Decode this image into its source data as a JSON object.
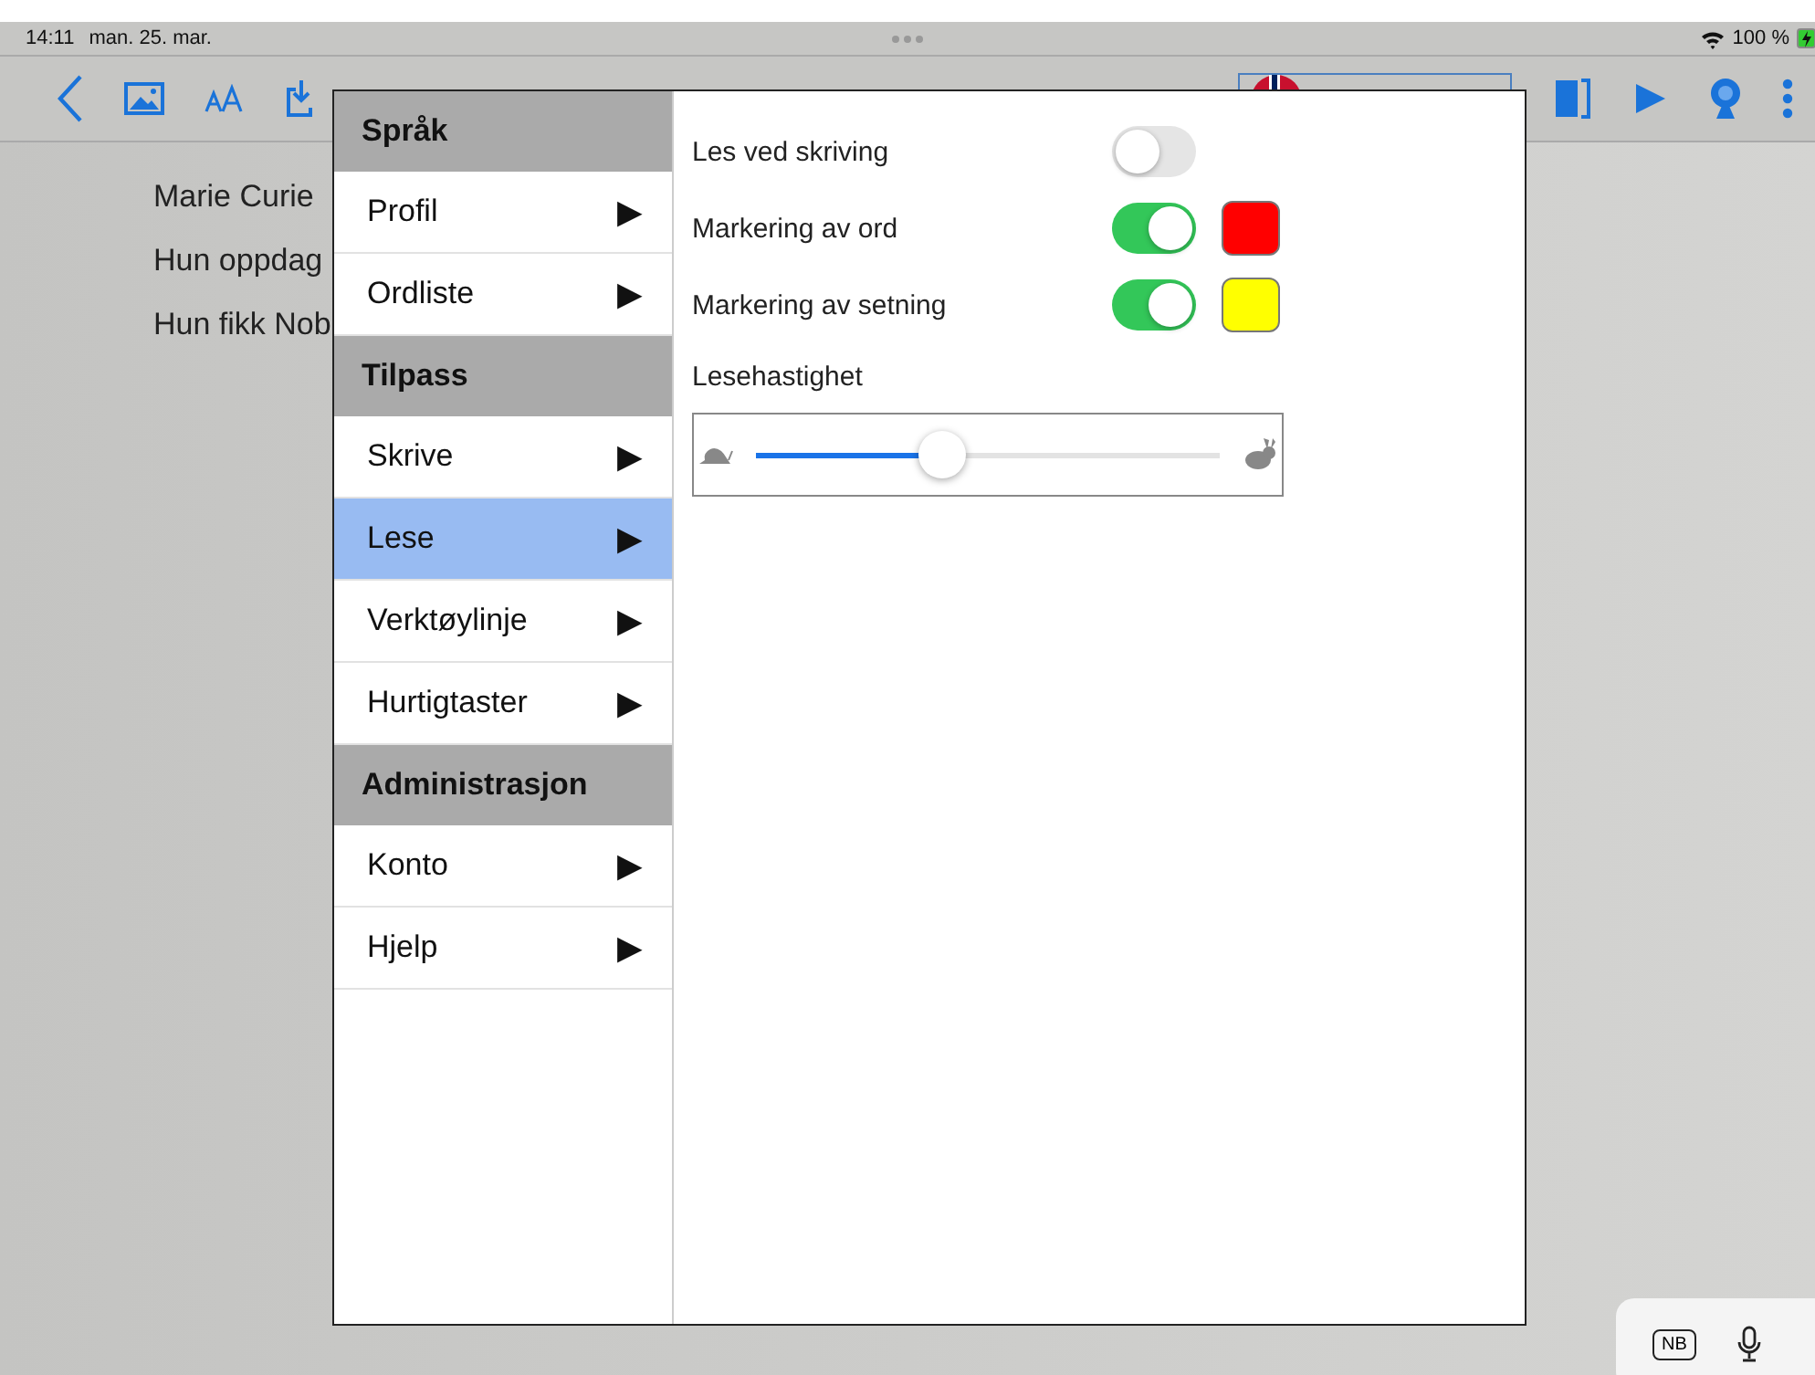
{
  "status_bar": {
    "time": "14:11",
    "date": "man. 25. mar.",
    "battery": "100 %"
  },
  "document": {
    "lines": [
      "Marie Curie",
      "Hun oppdag",
      "Hun fikk Nob"
    ]
  },
  "menu": [
    {
      "heading": "Språk",
      "items": [
        {
          "label": "Profil",
          "arrow": "▶",
          "selected": false
        },
        {
          "label": "Ordliste",
          "arrow": "▶",
          "selected": false
        }
      ]
    },
    {
      "heading": "Tilpass",
      "items": [
        {
          "label": "Skrive",
          "arrow": "▶",
          "selected": false
        },
        {
          "label": "Lese",
          "arrow": "▶",
          "selected": true
        },
        {
          "label": "Verktøylinje",
          "arrow": "▶",
          "selected": false
        },
        {
          "label": "Hurtigtaster",
          "arrow": "▶",
          "selected": false
        }
      ]
    },
    {
      "heading": "Administrasjon",
      "items": [
        {
          "label": "Konto",
          "arrow": "▶",
          "selected": false
        },
        {
          "label": "Hjelp",
          "arrow": "▶",
          "selected": false
        }
      ]
    }
  ],
  "settings": [
    {
      "kind": "toggle",
      "label": "Les ved skriving",
      "on": false
    },
    {
      "kind": "toggle",
      "label": "Markering av ord",
      "on": true,
      "color": "#ff0000"
    },
    {
      "kind": "toggle",
      "label": "Markering av setning",
      "on": true,
      "color": "#ffff00"
    },
    {
      "kind": "slider",
      "label": "Lesehastighet",
      "level": 0.4
    }
  ],
  "keyboard_bar": {
    "language": "NB"
  }
}
